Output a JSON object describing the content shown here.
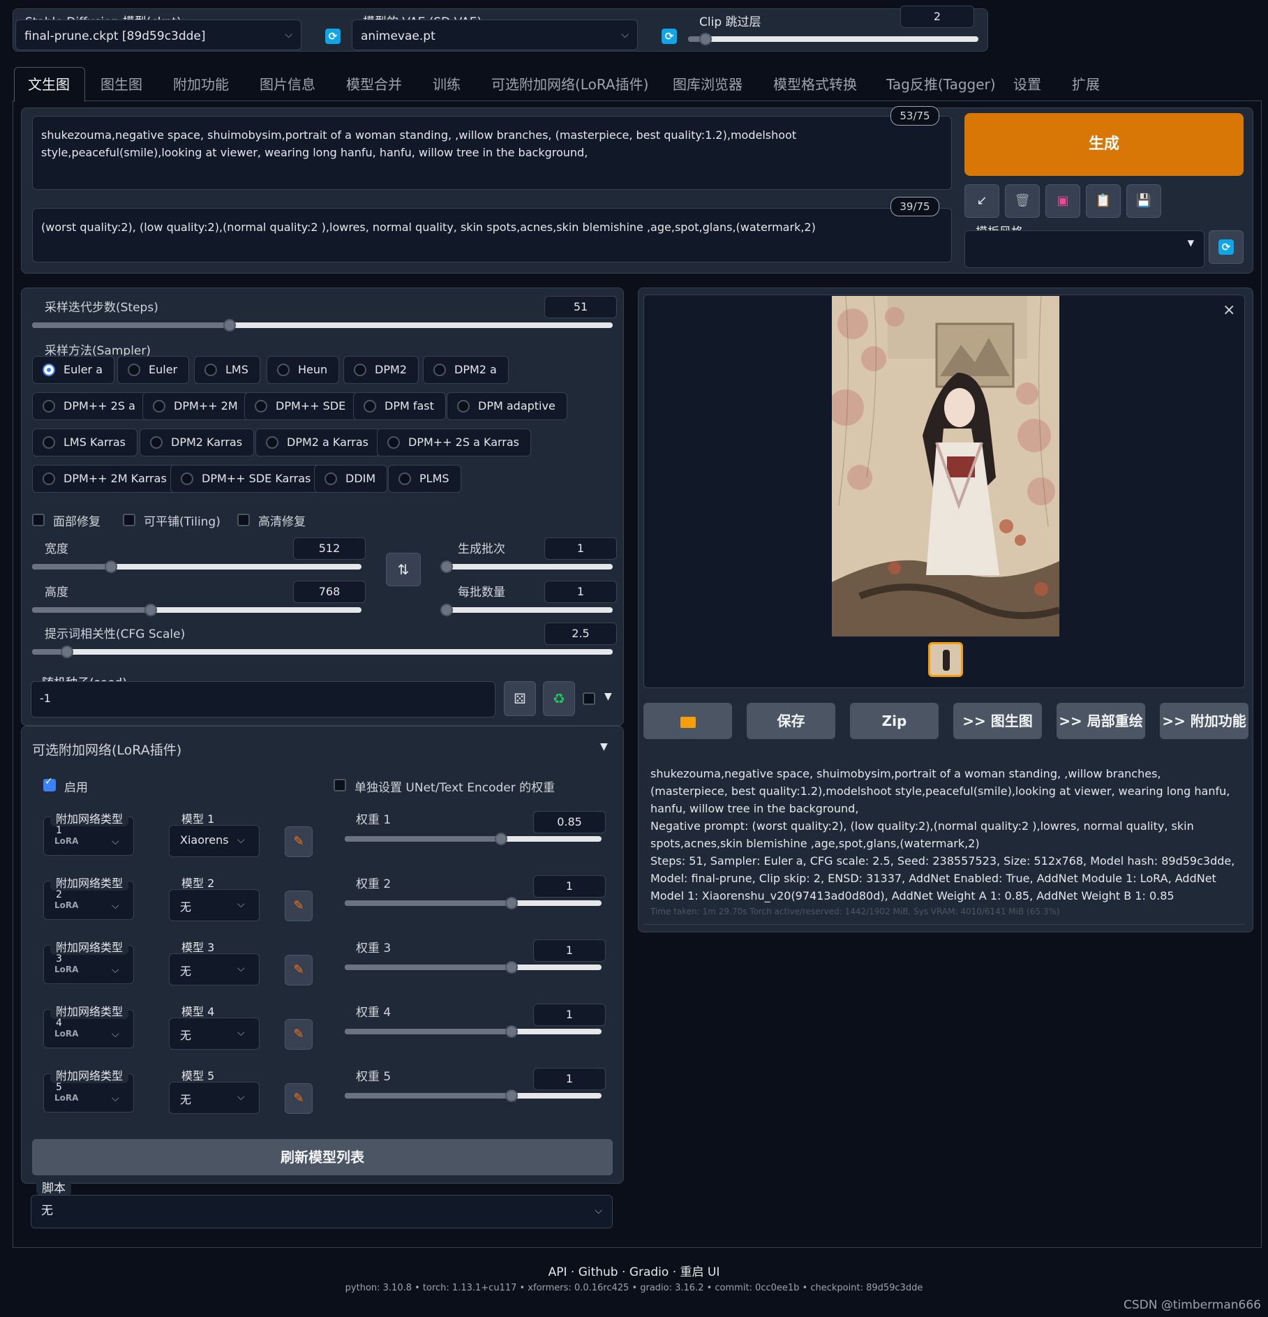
{
  "top": {
    "ckpt": {
      "label": "Stable Diffusion 模型(ckpt)",
      "value": "final-prune.ckpt [89d59c3dde]"
    },
    "vae": {
      "label": "模型的 VAE (SD VAE)",
      "value": "animevae.pt"
    },
    "clip": {
      "label": "Clip 跳过层",
      "value": "2",
      "fraction": 0.06
    }
  },
  "tabs": [
    "文生图",
    "图生图",
    "附加功能",
    "图片信息",
    "模型合并",
    "训练",
    "可选附加网络(LoRA插件)",
    "图库浏览器",
    "模型格式转换",
    "Tag反推(Tagger)",
    "设置",
    "扩展"
  ],
  "prompt": {
    "text": "shukezouma,negative space, shuimobysim,portrait of a woman standing, ,willow branches, (masterpiece, best quality:1.2),modelshoot style,peaceful(smile),looking at viewer, wearing long hanfu, hanfu, willow tree in the background,",
    "count": "53/75"
  },
  "negative": {
    "text": "(worst quality:2), (low quality:2),(normal quality:2 ),lowres, normal quality, skin spots,acnes,skin blemishine ,age,spot,glans,(watermark,2)",
    "count": "39/75"
  },
  "generate_label": "生成",
  "style": {
    "label": "模板风格",
    "value": ""
  },
  "tool_icons": [
    "arrow-down-left-icon",
    "trash-icon",
    "pink-card-icon",
    "clipboard-icon",
    "save-disk-icon"
  ],
  "steps": {
    "label": "采样迭代步数(Steps)",
    "value": "51",
    "fraction": 0.34
  },
  "sampler": {
    "label": "采样方法(Sampler)",
    "selected": "Euler a",
    "rows": [
      [
        "Euler a",
        "Euler",
        "LMS",
        "Heun",
        "DPM2",
        "DPM2 a"
      ],
      [
        "DPM++ 2S a",
        "DPM++ 2M",
        "DPM++ SDE",
        "DPM fast",
        "DPM adaptive"
      ],
      [
        "LMS Karras",
        "DPM2 Karras",
        "DPM2 a Karras",
        "DPM++ 2S a Karras"
      ],
      [
        "DPM++ 2M Karras",
        "DPM++ SDE Karras",
        "DDIM",
        "PLMS"
      ]
    ]
  },
  "options": [
    "面部修复",
    "可平铺(Tiling)",
    "高清修复"
  ],
  "width": {
    "label": "宽度",
    "value": "512",
    "fraction": 0.24
  },
  "height": {
    "label": "高度",
    "value": "768",
    "fraction": 0.36
  },
  "batch_count": {
    "label": "生成批次",
    "value": "1",
    "fraction": 0.0
  },
  "batch_size": {
    "label": "每批数量",
    "value": "1",
    "fraction": 0.0
  },
  "cfg": {
    "label": "提示词相关性(CFG Scale)",
    "value": "2.5",
    "fraction": 0.06
  },
  "seed": {
    "label": "随机种子(seed)",
    "value": "-1"
  },
  "lora": {
    "title": "可选附加网络(LoRA插件)",
    "enable_label": "启用",
    "separate_label": "单独设置 UNet/Text Encoder 的权重",
    "rows": [
      {
        "type_label": "附加网络类型",
        "idx": "1",
        "type": "LoRA",
        "model_label": "模型 1",
        "model": "Xiaorens",
        "weight_label": "权重 1",
        "weight": "0.85",
        "fraction": 0.61
      },
      {
        "type_label": "附加网络类型",
        "idx": "2",
        "type": "LoRA",
        "model_label": "模型 2",
        "model": "无",
        "weight_label": "权重 2",
        "weight": "1",
        "fraction": 0.65
      },
      {
        "type_label": "附加网络类型",
        "idx": "3",
        "type": "LoRA",
        "model_label": "模型 3",
        "model": "无",
        "weight_label": "权重 3",
        "weight": "1",
        "fraction": 0.65
      },
      {
        "type_label": "附加网络类型",
        "idx": "4",
        "type": "LoRA",
        "model_label": "模型 4",
        "model": "无",
        "weight_label": "权重 4",
        "weight": "1",
        "fraction": 0.65
      },
      {
        "type_label": "附加网络类型",
        "idx": "5",
        "type": "LoRA",
        "model_label": "模型 5",
        "model": "无",
        "weight_label": "权重 5",
        "weight": "1",
        "fraction": 0.65
      }
    ],
    "refresh_label": "刷新模型列表"
  },
  "script": {
    "label": "脚本",
    "value": "无"
  },
  "gallery_buttons": [
    "保存",
    "Zip",
    ">> 图生图",
    ">> 局部重绘",
    ">> 附加功能"
  ],
  "info": {
    "prompt": "shukezouma,negative space, shuimobysim,portrait of a woman standing, ,willow branches, (masterpiece, best quality:1.2),modelshoot style,peaceful(smile),looking at viewer, wearing long hanfu, hanfu, willow tree in the background,",
    "negative": "Negative prompt: (worst quality:2), (low quality:2),(normal quality:2 ),lowres, normal quality, skin spots,acnes,skin blemishine ,age,spot,glans,(watermark,2)",
    "params": "Steps: 51, Sampler: Euler a, CFG scale: 2.5, Seed: 238557523, Size: 512x768, Model hash: 89d59c3dde, Model: final-prune, Clip skip: 2, ENSD: 31337, AddNet Enabled: True, AddNet Module 1: LoRA, AddNet Model 1: Xiaorenshu_v20(97413ad0d80d), AddNet Weight A 1: 0.85, AddNet Weight B 1: 0.85",
    "timing": "Time taken: 1m 29.70s  Torch active/reserved: 1442/1902 MiB, Sys VRAM: 4010/6141 MiB (65.3%)"
  },
  "footer": {
    "links": "API  ·  Github  ·  Gradio  ·  重启 UI",
    "versions": "python: 3.10.8  •  torch: 1.13.1+cu117  •  xformers: 0.0.16rc425  •  gradio: 3.16.2  •  commit: 0cc0ee1b  •  checkpoint: 89d59c3dde",
    "watermark": "CSDN @timberman666"
  }
}
